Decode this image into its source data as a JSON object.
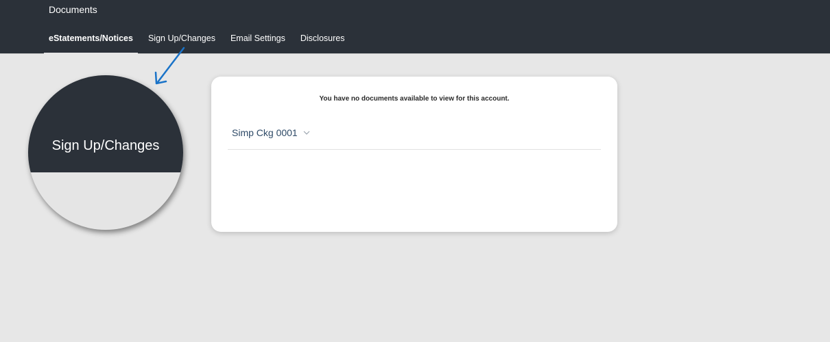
{
  "header": {
    "title": "Documents",
    "tabs": [
      {
        "label": "eStatements/Notices",
        "active": true
      },
      {
        "label": "Sign Up/Changes",
        "active": false
      },
      {
        "label": "Email Settings",
        "active": false
      },
      {
        "label": "Disclosures",
        "active": false
      }
    ]
  },
  "magnifier": {
    "label": "Sign Up/Changes",
    "arrow_icon": "arrow-down-left-icon",
    "arrow_color": "#1a73c8"
  },
  "card": {
    "empty_message": "You have no documents available to view for this account.",
    "account_select": {
      "value": "Simp Ckg 0001",
      "icon": "chevron-down-icon"
    }
  },
  "colors": {
    "header_bg": "#2b3139",
    "page_bg": "#e7e7e7",
    "card_bg": "#ffffff",
    "account_text": "#2e4a67"
  }
}
